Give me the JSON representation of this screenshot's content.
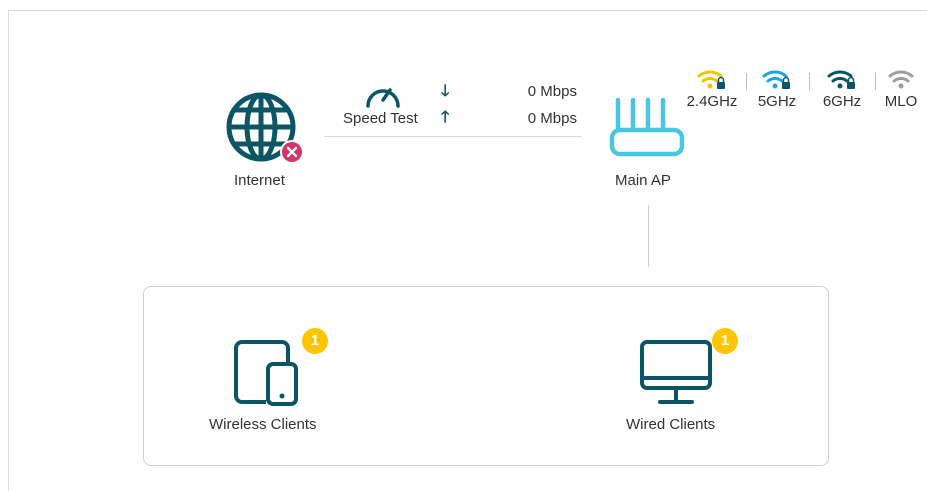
{
  "topology": {
    "internet": {
      "label": "Internet",
      "status": "disconnected"
    },
    "speed_test": {
      "label": "Speed Test",
      "download": "0 Mbps",
      "upload": "0 Mbps"
    },
    "main_ap": {
      "label": "Main AP"
    },
    "bands": [
      {
        "label": "2.4GHz",
        "color": "#f5c400",
        "icon": "wifi-lock-icon"
      },
      {
        "label": "5GHz",
        "color": "#1aa7de",
        "icon": "wifi-lock-icon"
      },
      {
        "label": "6GHz",
        "color": "#0b5566",
        "icon": "wifi-lock-icon"
      },
      {
        "label": "MLO",
        "color": "#9e9e9e",
        "icon": "wifi-icon"
      }
    ]
  },
  "clients": {
    "wireless": {
      "label": "Wireless Clients",
      "count": "1"
    },
    "wired": {
      "label": "Wired Clients",
      "count": "1"
    }
  },
  "colors": {
    "primary_icon": "#0b5566",
    "error": "#d6336c",
    "badge": "#ffc600",
    "router": "#49c6e5"
  }
}
